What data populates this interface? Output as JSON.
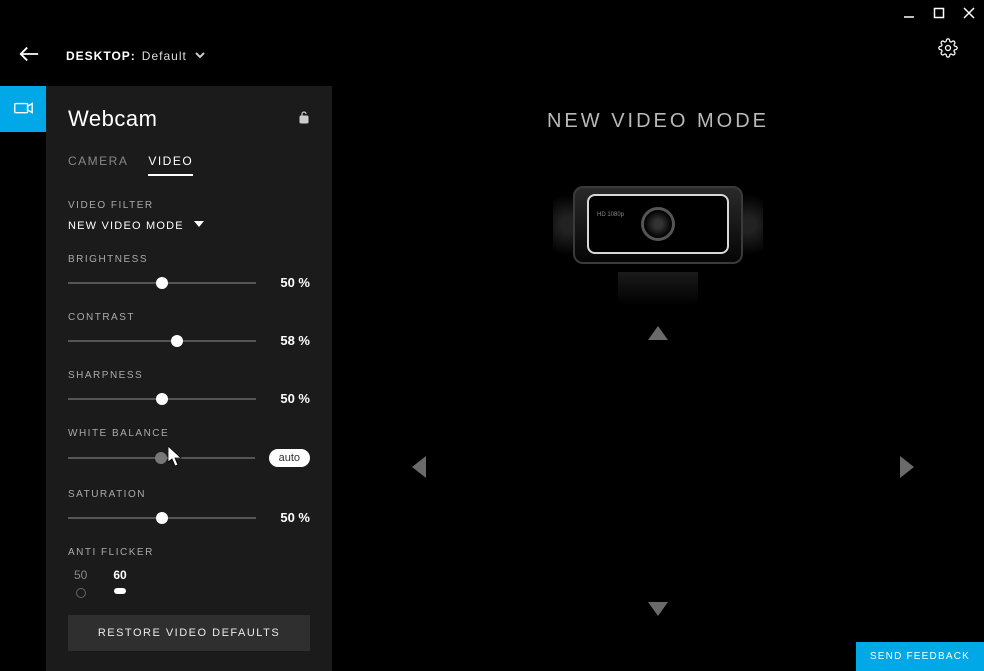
{
  "desktop_label": "DESKTOP:",
  "desktop_profile": "Default",
  "sidebar": {
    "title": "Webcam",
    "tabs": {
      "camera": "CAMERA",
      "video": "VIDEO"
    },
    "filter_section": "VIDEO FILTER",
    "filter_value": "NEW VIDEO MODE",
    "sliders": {
      "brightness": {
        "label": "BRIGHTNESS",
        "value": "50 %",
        "pos": 50
      },
      "contrast": {
        "label": "CONTRAST",
        "value": "58 %",
        "pos": 58
      },
      "sharpness": {
        "label": "SHARPNESS",
        "value": "50 %",
        "pos": 50
      },
      "whitebalance": {
        "label": "WHITE BALANCE",
        "auto_label": "auto",
        "pos": 50
      },
      "saturation": {
        "label": "SATURATION",
        "value": "50 %",
        "pos": 50
      }
    },
    "antiflicker": {
      "label": "ANTI FLICKER",
      "opt50": "50",
      "opt60": "60"
    },
    "restore": "RESTORE VIDEO DEFAULTS"
  },
  "main": {
    "mode_title": "NEW VIDEO MODE",
    "cam_text": "HD 1080p"
  },
  "feedback": "SEND FEEDBACK"
}
